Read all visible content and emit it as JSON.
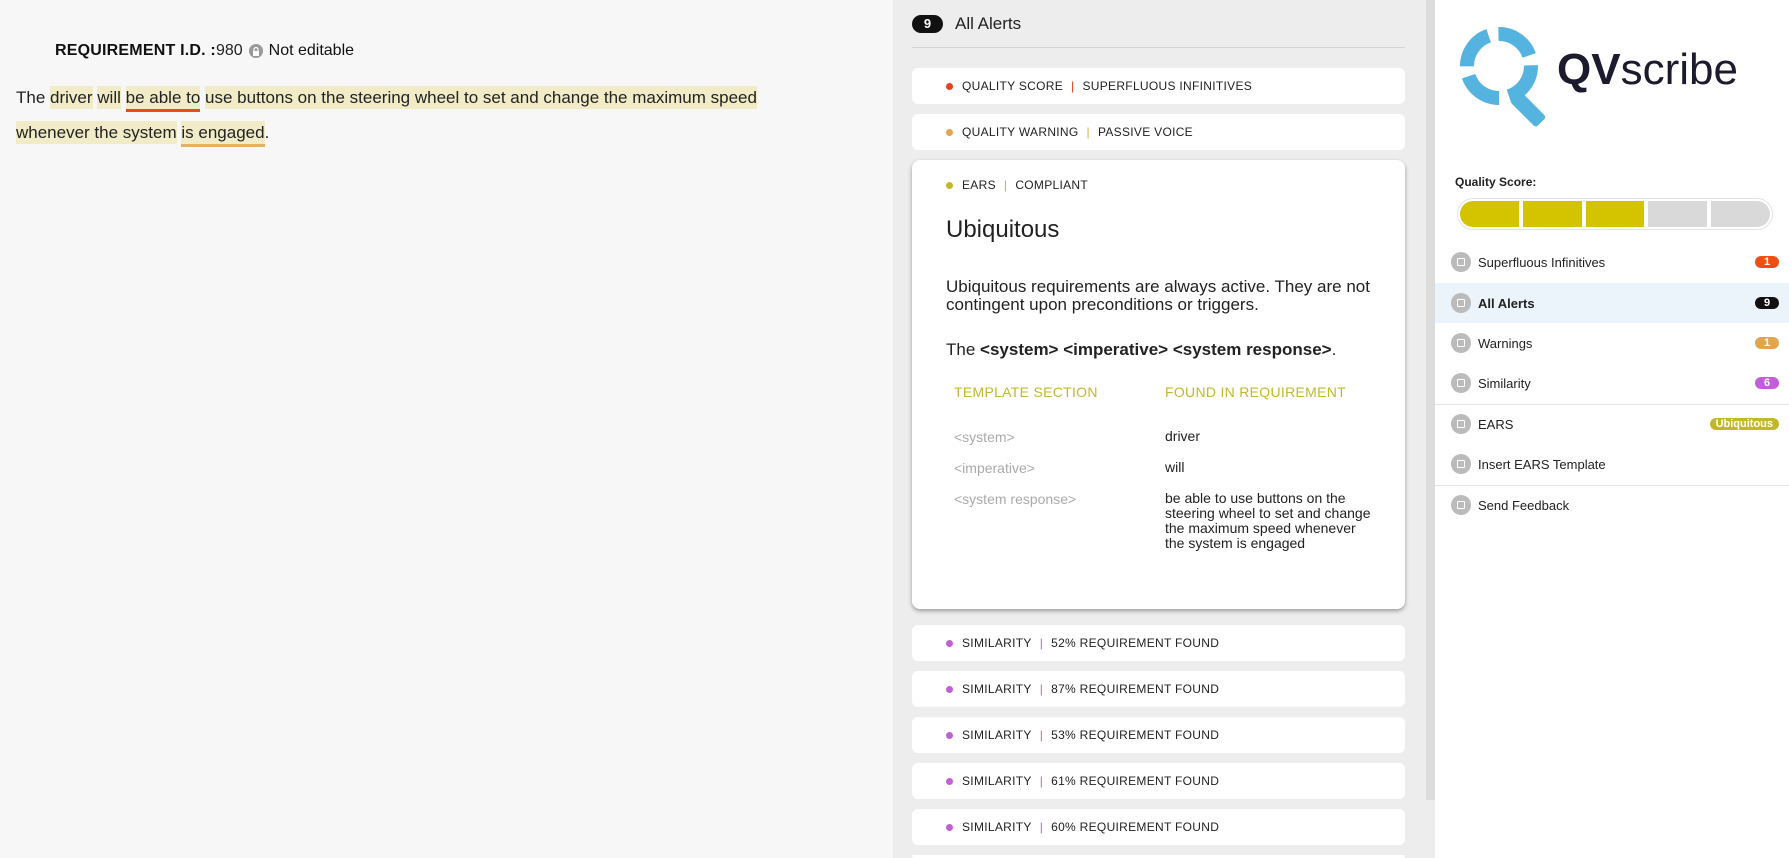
{
  "editor": {
    "req_label": "REQUIREMENT I.D. :",
    "req_id": "980",
    "not_editable": "Not editable",
    "text": {
      "w1": "The",
      "w2": "driver",
      "w3": "will",
      "w4": "be able to",
      "w5": "use buttons on the steering wheel to set and change the maximum speed",
      "w6": "whenever the system",
      "w7": "is engaged",
      "w8": "."
    }
  },
  "alerts": {
    "count": "9",
    "title": "All Alerts",
    "rows_top": [
      {
        "category": "QUALITY SCORE",
        "detail": "SUPERFLUOUS INFINITIVES",
        "color": "#e8401a"
      },
      {
        "category": "QUALITY WARNING",
        "detail": "PASSIVE VOICE",
        "color": "#e0a64f"
      }
    ],
    "card": {
      "category": "EARS",
      "detail": "COMPLIANT",
      "color": "#c3b829",
      "title": "Ubiquitous",
      "description": "Ubiquitous requirements are always active. They are not contingent upon preconditions or triggers.",
      "template_prefix": "The",
      "template_bold": "<system> <imperative> <system response>",
      "template_suffix": ".",
      "col_left": "TEMPLATE SECTION",
      "col_right": "FOUND IN REQUIREMENT",
      "rows": [
        {
          "section": "<system>",
          "found": "driver"
        },
        {
          "section": "<imperative>",
          "found": "will"
        },
        {
          "section": "<system response>",
          "found": "be able to use buttons on the steering wheel to set and change the maximum speed whenever the system is engaged"
        }
      ]
    },
    "rows_bottom": [
      {
        "category": "SIMILARITY",
        "detail": "52% REQUIREMENT FOUND",
        "color": "#c25ed8"
      },
      {
        "category": "SIMILARITY",
        "detail": "87% REQUIREMENT FOUND",
        "color": "#c25ed8"
      },
      {
        "category": "SIMILARITY",
        "detail": "53% REQUIREMENT FOUND",
        "color": "#c25ed8"
      },
      {
        "category": "SIMILARITY",
        "detail": "61% REQUIREMENT FOUND",
        "color": "#c25ed8"
      },
      {
        "category": "SIMILARITY",
        "detail": "60% REQUIREMENT FOUND",
        "color": "#c25ed8"
      }
    ]
  },
  "sidebar": {
    "logo_q": "QV",
    "logo_rest": "scribe",
    "quality_label": "Quality Score:",
    "quality_level": 3,
    "quality_max": 5,
    "items": [
      {
        "label": "Superfluous Infinitives",
        "badge": "1",
        "badge_color": "#f04e12",
        "icon": "puzzle-icon"
      },
      {
        "label": "All Alerts",
        "badge": "9",
        "badge_color": "#111111",
        "icon": "inbox-icon"
      },
      {
        "label": "Warnings",
        "badge": "1",
        "badge_color": "#e0a64f",
        "icon": "warning-icon"
      },
      {
        "label": "Similarity",
        "badge": "6",
        "badge_color": "#c25ed8",
        "icon": "overlap-icon"
      },
      {
        "label": "EARS",
        "badge": "Ubiquitous",
        "badge_color": "#c3b829",
        "icon": "ears-icon"
      },
      {
        "label": "Insert EARS Template",
        "badge": "",
        "icon": "calendar-icon"
      },
      {
        "label": "Send Feedback",
        "badge": "",
        "icon": "send-icon"
      }
    ]
  }
}
